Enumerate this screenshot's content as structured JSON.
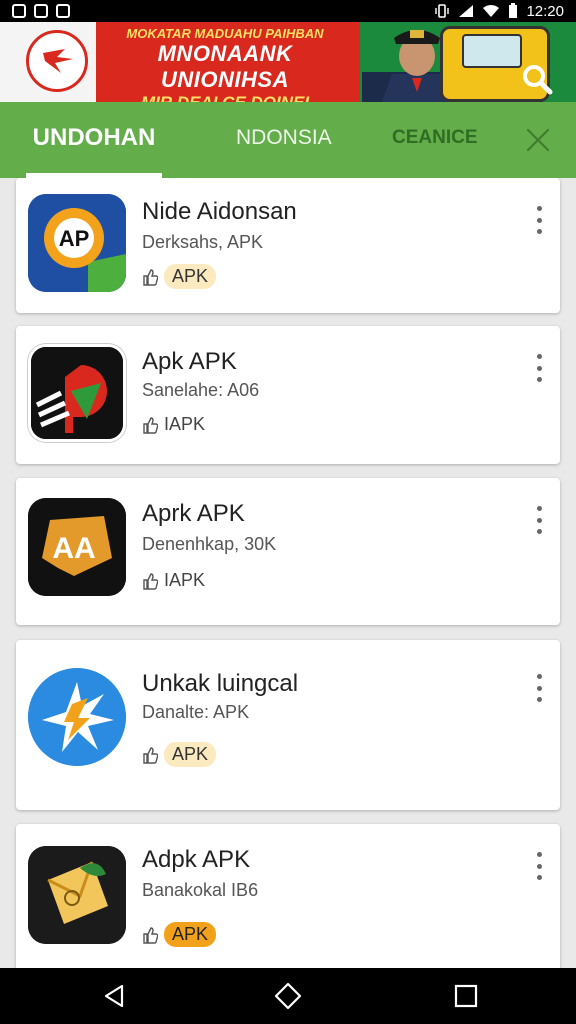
{
  "status_bar": {
    "time": "12:20",
    "icons": [
      "screenshot-icon",
      "camera-icon",
      "cast-icon",
      "vibrate-icon",
      "signal-icon",
      "wifi-icon",
      "battery-icon"
    ]
  },
  "banner": {
    "line1": "MOKATAR MADUAHU PAIHBAN",
    "line2": "MNONAANK UNIONIHSA",
    "line3": "MIR DEAI CE DOINEI",
    "icons": [
      "logo-icon",
      "search-icon"
    ]
  },
  "tabs": [
    {
      "label": "UNDOHAN",
      "active": true
    },
    {
      "label": "NDONSIA",
      "active": false
    },
    {
      "label": "CEANICE",
      "active": false
    }
  ],
  "apps": [
    {
      "title": "Nide Aidonsan",
      "subtitle": "Derksahs, APK",
      "tag": "APK",
      "tag_style": "pill",
      "icon": "ap-badge-icon",
      "icon_text": "AP"
    },
    {
      "title": "Apk APK",
      "subtitle": "Sanelahe: A06",
      "tag": "IAPK",
      "tag_style": "plain",
      "icon": "p-arrow-icon",
      "icon_text": ""
    },
    {
      "title": "Aprk APK",
      "subtitle": "Denenhkap, 30K",
      "tag": "IAPK",
      "tag_style": "plain",
      "icon": "aa-shield-icon",
      "icon_text": "AA"
    },
    {
      "title": "Unkak luingcal",
      "subtitle": "Danalte: APK",
      "tag": "APK",
      "tag_style": "pill",
      "icon": "sun-bolt-icon",
      "icon_text": ""
    },
    {
      "title": "Adpk APK",
      "subtitle": "Banakokal IB6",
      "tag": "APK",
      "tag_style": "pill-orange",
      "icon": "envelope-leaf-icon",
      "icon_text": ""
    }
  ],
  "nav_bar": {
    "buttons": [
      "back-icon",
      "home-icon",
      "recents-icon"
    ]
  },
  "colors": {
    "tab_bar": "#64ad4b",
    "banner_red": "#d9281e",
    "banner_green": "#1b8a3c",
    "pill": "#fbe9bf",
    "pill_orange": "#f2a21a"
  }
}
